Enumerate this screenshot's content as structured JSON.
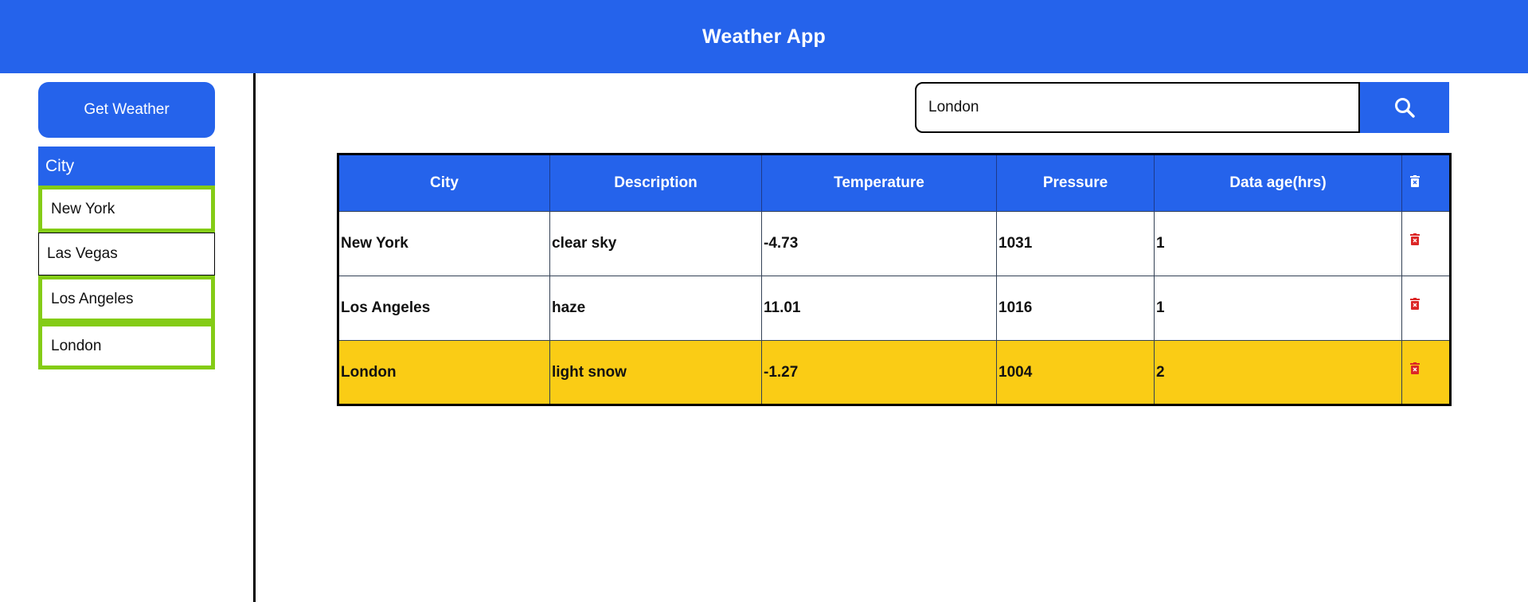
{
  "header": {
    "title": "Weather App"
  },
  "sidebar": {
    "get_weather_label": "Get Weather",
    "city_header": "City",
    "cities": [
      {
        "name": "New York",
        "selected": true
      },
      {
        "name": "Las Vegas",
        "selected": false
      },
      {
        "name": "Los Angeles",
        "selected": true
      },
      {
        "name": "London",
        "selected": true
      }
    ]
  },
  "search": {
    "value": "London",
    "button_icon": "search-icon"
  },
  "table": {
    "columns": [
      "City",
      "Description",
      "Temperature",
      "Pressure",
      "Data age(hrs)"
    ],
    "header_icon": "trash-icon",
    "rows": [
      {
        "city": "New York",
        "description": "clear sky",
        "temperature": "-4.73",
        "pressure": "1031",
        "age": "1",
        "highlighted": false
      },
      {
        "city": "Los Angeles",
        "description": "haze",
        "temperature": "11.01",
        "pressure": "1016",
        "age": "1",
        "highlighted": false
      },
      {
        "city": "London",
        "description": "light snow",
        "temperature": "-1.27",
        "pressure": "1004",
        "age": "2",
        "highlighted": true
      }
    ]
  },
  "colors": {
    "primary": "#2563eb",
    "selected_border": "#84cc16",
    "highlight_row": "#facc15",
    "delete_icon": "#dc2626"
  }
}
